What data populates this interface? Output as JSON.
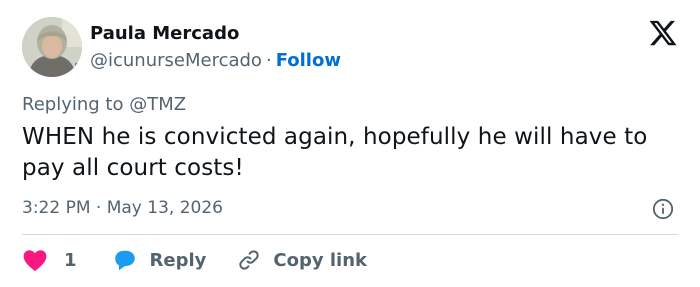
{
  "author": {
    "name": "Paula Mercado",
    "handle": "@icunurseMercado",
    "separator": "·",
    "follow_label": "Follow"
  },
  "reply_to": "Replying to @TMZ",
  "tweet": {
    "text": "WHEN he is convicted again, hopefully he will have to pay all court costs!",
    "timestamp": "3:22 PM · May 13, 2026"
  },
  "actions": {
    "like_count": "1",
    "reply_label": "Reply",
    "copy_label": "Copy link"
  },
  "colors": {
    "text": "#0f1419",
    "secondary": "#536471",
    "link": "#006fd6",
    "heart": "#f91880",
    "reply_bubble": "#1d9bf0",
    "divider": "#cfd9de"
  },
  "icons": {
    "logo": "x-logo-icon",
    "info": "info-icon",
    "like": "heart-icon",
    "reply": "speech-bubble-icon",
    "copy": "link-icon"
  }
}
